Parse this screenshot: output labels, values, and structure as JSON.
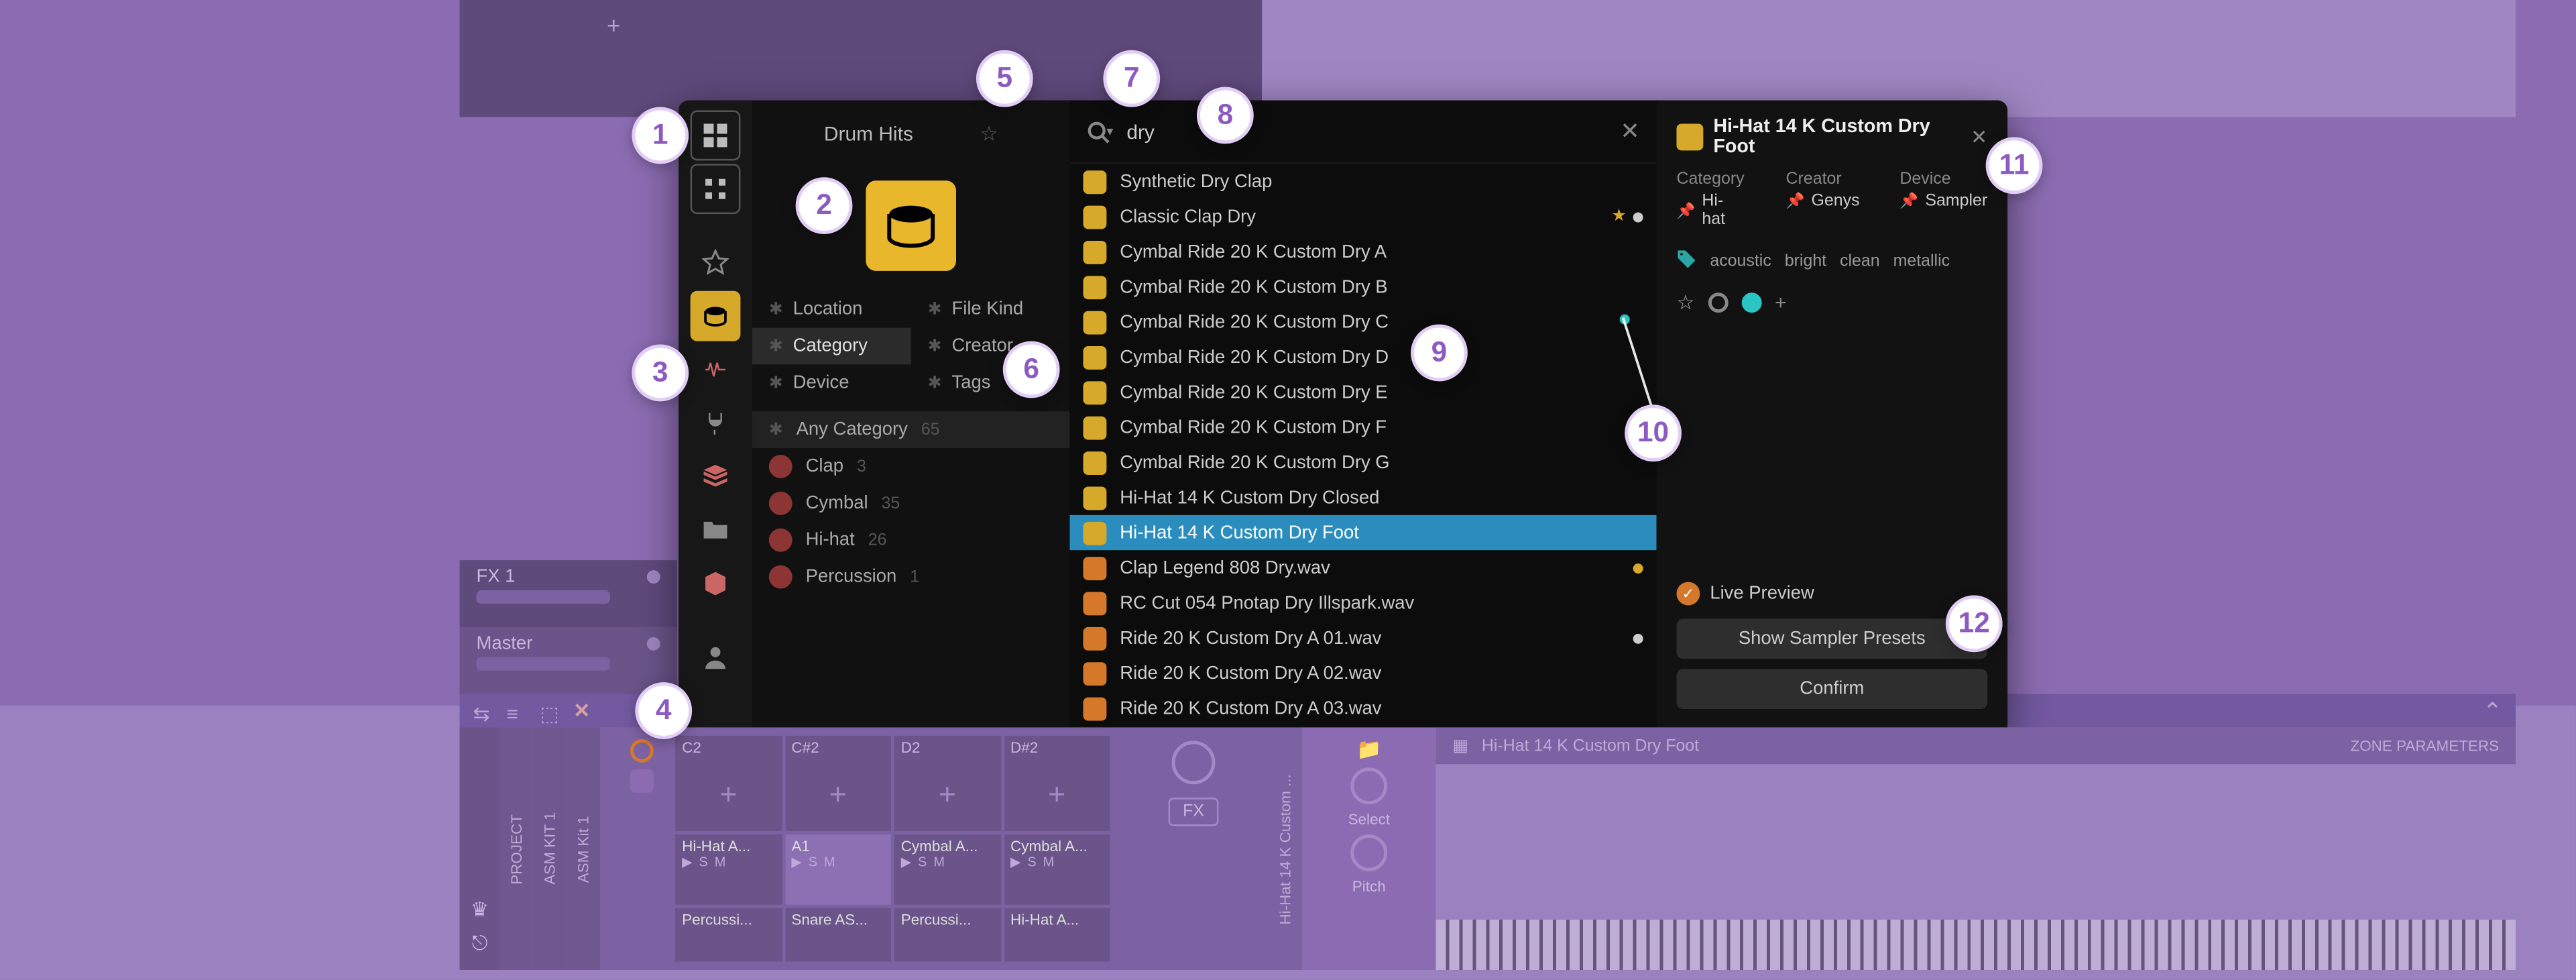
{
  "browser": {
    "title": "Drum Hits",
    "search_value": "dry",
    "filters": {
      "left": [
        "Location",
        "Category",
        "Device"
      ],
      "right": [
        "File Kind",
        "Creator",
        "Tags"
      ],
      "active": "Category"
    },
    "any_category": {
      "label": "Any Category",
      "count": "65"
    },
    "categories": [
      {
        "name": "Clap",
        "count": "3"
      },
      {
        "name": "Cymbal",
        "count": "35"
      },
      {
        "name": "Hi-hat",
        "count": "26"
      },
      {
        "name": "Percussion",
        "count": "1"
      }
    ],
    "results": [
      {
        "name": "Synthetic Dry Clap",
        "icon": "yellow"
      },
      {
        "name": "Classic Clap Dry",
        "icon": "yellow",
        "star": true,
        "dot": true
      },
      {
        "name": "Cymbal Ride 20 K Custom Dry A",
        "icon": "yellow"
      },
      {
        "name": "Cymbal Ride 20 K Custom Dry B",
        "icon": "yellow"
      },
      {
        "name": "Cymbal Ride 20 K Custom Dry C",
        "icon": "yellow"
      },
      {
        "name": "Cymbal Ride 20 K Custom Dry D",
        "icon": "yellow"
      },
      {
        "name": "Cymbal Ride 20 K Custom Dry E",
        "icon": "yellow"
      },
      {
        "name": "Cymbal Ride 20 K Custom Dry F",
        "icon": "yellow"
      },
      {
        "name": "Cymbal Ride 20 K Custom Dry G",
        "icon": "yellow"
      },
      {
        "name": "Hi-Hat 14 K Custom Dry Closed",
        "icon": "yellow"
      },
      {
        "name": "Hi-Hat 14 K Custom Dry Foot",
        "icon": "yellow",
        "selected": true
      },
      {
        "name": "Clap Legend 808 Dry.wav",
        "icon": "orange",
        "starY": true
      },
      {
        "name": "RC Cut 054 Pnotap Dry Illspark.wav",
        "icon": "orange"
      },
      {
        "name": "Ride 20 K Custom Dry A 01.wav",
        "icon": "orange",
        "dot": true
      },
      {
        "name": "Ride 20 K Custom Dry A 02.wav",
        "icon": "orange"
      },
      {
        "name": "Ride 20 K Custom Dry A 03.wav",
        "icon": "orange"
      }
    ]
  },
  "detail": {
    "title": "Hi-Hat 14 K Custom Dry Foot",
    "meta": {
      "category": {
        "label": "Category",
        "value": "Hi-hat"
      },
      "creator": {
        "label": "Creator",
        "value": "Genys"
      },
      "device": {
        "label": "Device",
        "value": "Sampler"
      }
    },
    "tags": [
      "acoustic",
      "bright",
      "clean",
      "metallic"
    ],
    "live_preview": "Live Preview",
    "btn_presets": "Show Sampler Presets",
    "btn_confirm": "Confirm"
  },
  "tracks": {
    "fx1": "FX 1",
    "master": "Master"
  },
  "device_area": {
    "vert_labels": [
      "PROJECT",
      "ASM KIT 1",
      "ASM Kit 1"
    ],
    "pad_keys": [
      "C2",
      "C#2",
      "D2",
      "D#2"
    ],
    "pad_names_row2": [
      "Hi-Hat A...",
      "A1",
      "Cymbal A...",
      "Cymbal A..."
    ],
    "pad_names_row3": [
      "Percussi...",
      "Snare AS...",
      "Percussi...",
      "Hi-Hat A..."
    ],
    "fx_label": "FX",
    "zone_title": "Hi-Hat 14 K Custom Dry Foot",
    "zone_params": "ZONE PARAMETERS",
    "select_label": "Select",
    "pitch_label": "Pitch",
    "vert_sample": "Hi-Hat 14 K Custom ..."
  },
  "annotations": [
    "1",
    "2",
    "3",
    "4",
    "5",
    "6",
    "7",
    "8",
    "9",
    "10",
    "11",
    "12"
  ]
}
